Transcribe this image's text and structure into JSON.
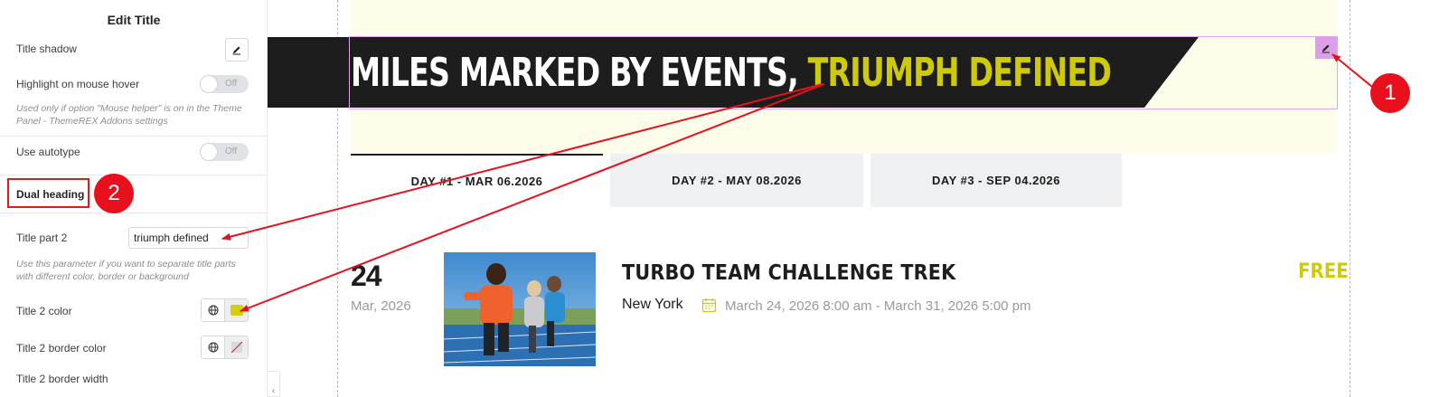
{
  "panel": {
    "title": "Edit Title",
    "title_shadow_label": "Title shadow",
    "highlight_label": "Highlight on mouse hover",
    "highlight_toggle": "Off",
    "highlight_note": "Used only if option \"Mouse helper\" is on in the Theme Panel - ThemeREX Addons settings",
    "autotype_label": "Use autotype",
    "autotype_toggle": "Off",
    "dual_heading_label": "Dual heading",
    "title_part2_label": "Title part 2",
    "title_part2_value": "triumph  defined",
    "title_part2_note": "Use this parameter if you want to separate title parts with different color, border or background",
    "title2_color_label": "Title 2 color",
    "title2_color_value": "#d4cf0a",
    "title2_border_color_label": "Title 2 border color",
    "title2_border_width_label": "Title 2 border width"
  },
  "callouts": {
    "badge1": "1",
    "badge2": "2",
    "color": "#e8101d"
  },
  "hero": {
    "heading_part1": "MILES MARKED BY EVENTS,",
    "heading_part2": "TRIUMPH DEFINED",
    "part2_color": "#cfc90c"
  },
  "tabs": [
    {
      "label": "DAY #1 - MAR 06.2026",
      "active": true
    },
    {
      "label": "DAY #2 - MAY 08.2026",
      "active": false
    },
    {
      "label": "DAY #3 - SEP 04.2026",
      "active": false
    }
  ],
  "event": {
    "day": "24",
    "month_year": "Mar, 2026",
    "title": "TURBO TEAM CHALLENGE TREK",
    "city": "New York",
    "dates": "March 24, 2026 8:00 am  -  March 31, 2026 5:00 pm",
    "price": "FREE",
    "image_icon": "runners-photo"
  },
  "icons": {
    "edit": "pencil-icon",
    "globe": "globe-icon",
    "calendar": "calendar-icon",
    "no_color": "no-color-icon"
  }
}
